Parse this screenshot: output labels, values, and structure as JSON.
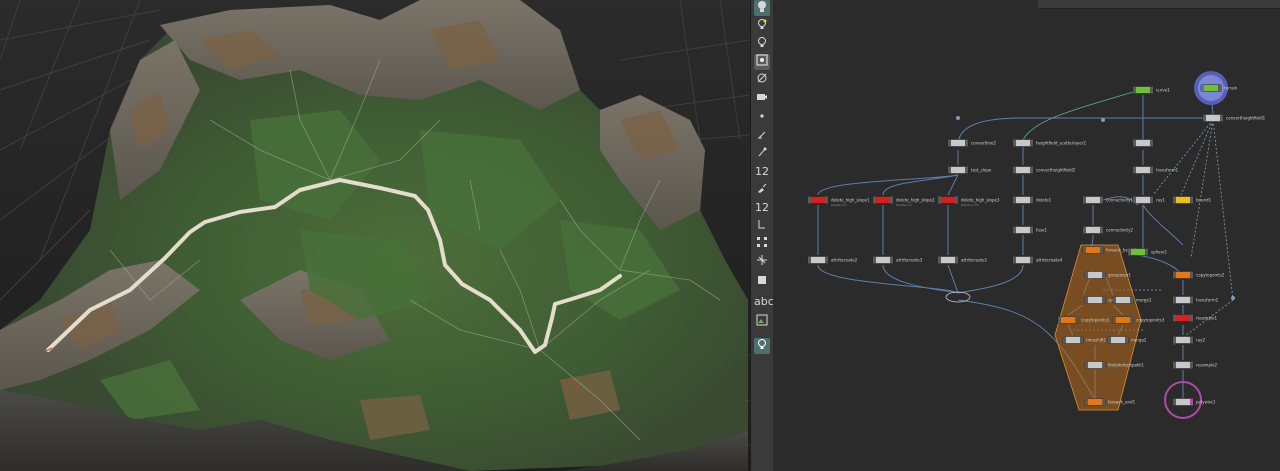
{
  "toolbar": {
    "tools": [
      {
        "icon": "select-icon"
      },
      {
        "icon": "light-bulb-icon"
      },
      {
        "icon": "light-bulb-icon"
      },
      {
        "icon": "display-options-icon"
      },
      {
        "icon": "snapping-icon"
      },
      {
        "icon": "camera-icon"
      },
      {
        "icon": "point-icon"
      },
      {
        "icon": "normals-icon"
      },
      {
        "icon": "pick-icon"
      },
      {
        "icon": "vertex-numbers-icon",
        "label": "12"
      },
      {
        "icon": "paint-icon"
      },
      {
        "icon": "primitive-numbers-icon",
        "label": "12"
      },
      {
        "icon": "wire-icon"
      },
      {
        "icon": "grid-icon"
      },
      {
        "icon": "scale-icon"
      },
      {
        "icon": "visualizer-icon"
      },
      {
        "icon": "text-tool-icon",
        "label": "abc"
      },
      {
        "icon": "image-icon"
      },
      {
        "icon": "light-bulb-icon"
      }
    ]
  },
  "network": {
    "nodes": [
      {
        "name": "curve1",
        "sub": "",
        "color": "#6fbf3a",
        "state": "normal"
      },
      {
        "name": "terrain",
        "sub": "",
        "color": "#6fbf3a",
        "state": "display"
      },
      {
        "name": "convertheightfield1",
        "sub": "",
        "color": "#c8c8c8",
        "state": "normal"
      },
      {
        "name": "convertline2",
        "sub": "",
        "color": "#c8c8c8",
        "state": "normal"
      },
      {
        "name": "heightfield_scatterlayer2",
        "sub": "",
        "color": "#c8c8c8",
        "state": "normal"
      },
      {
        "name": "",
        "sub": "",
        "color": "#c8c8c8",
        "state": "normal"
      },
      {
        "name": "test_slope",
        "sub": "",
        "color": "#c8c8c8",
        "state": "normal"
      },
      {
        "name": "convertheightfield2",
        "sub": "",
        "color": "#c8c8c8",
        "state": "normal"
      },
      {
        "name": "transform1",
        "sub": "",
        "color": "#c8c8c8",
        "state": "normal"
      },
      {
        "name": "delete_high_slope1",
        "sub": "Delete 0.3",
        "color": "#d42020",
        "state": "normal"
      },
      {
        "name": "delete_high_slope2",
        "sub": "Delete 0.3",
        "color": "#d42020",
        "state": "normal"
      },
      {
        "name": "delete_high_slope3",
        "sub": "Delete 0.35",
        "color": "#d42020",
        "state": "normal"
      },
      {
        "name": "delete1",
        "sub": "",
        "color": "#c8c8c8",
        "state": "normal"
      },
      {
        "name": "connectivity1",
        "sub": "",
        "color": "#c8c8c8",
        "state": "normal"
      },
      {
        "name": "ray1",
        "sub": "",
        "color": "#c8c8c8",
        "state": "normal"
      },
      {
        "name": "bound1",
        "sub": "",
        "color": "#e8c020",
        "state": "normal"
      },
      {
        "name": "fuse1",
        "sub": "",
        "color": "#c8c8c8",
        "state": "normal"
      },
      {
        "name": "connectivity2",
        "sub": "",
        "color": "#c8c8c8",
        "state": "normal"
      },
      {
        "name": "attribcreate2",
        "sub": "",
        "color": "#c8c8c8",
        "state": "normal"
      },
      {
        "name": "attribcreate3",
        "sub": "",
        "color": "#c8c8c8",
        "state": "normal"
      },
      {
        "name": "attribcreate1",
        "sub": "",
        "color": "#c8c8c8",
        "state": "normal"
      },
      {
        "name": "attribcreate4",
        "sub": "",
        "color": "#c8c8c8",
        "state": "normal"
      },
      {
        "name": "foreach_begin1",
        "sub": "",
        "color": "#e07818",
        "state": "normal"
      },
      {
        "name": "sphere1",
        "sub": "",
        "color": "#6fbf3a",
        "state": "normal"
      },
      {
        "name": "groupexpr1",
        "sub": "",
        "color": "#c8c8c8",
        "state": "normal"
      },
      {
        "name": "copytopoints2",
        "sub": "",
        "color": "#e07818",
        "state": "normal"
      },
      {
        "name": "split1",
        "sub": "",
        "color": "#c8c8c8",
        "state": "normal"
      },
      {
        "name": "merge1",
        "sub": "",
        "color": "#c8c8c8",
        "state": "normal"
      },
      {
        "name": "transform2",
        "sub": "",
        "color": "#c8c8c8",
        "state": "normal"
      },
      {
        "name": "copytopoints1",
        "sub": "",
        "color": "#e07818",
        "state": "normal"
      },
      {
        "name": "copytopoints3",
        "sub": "",
        "color": "#e07818",
        "state": "normal"
      },
      {
        "name": "resample1",
        "sub": "",
        "color": "#d42020",
        "state": "normal"
      },
      {
        "name": "timeshift1",
        "sub": "",
        "color": "#c8c8c8",
        "state": "normal"
      },
      {
        "name": "merge2",
        "sub": "",
        "color": "#c8c8c8",
        "state": "normal"
      },
      {
        "name": "ray2",
        "sub": "",
        "color": "#c8c8c8",
        "state": "normal"
      },
      {
        "name": "findshortestpath1",
        "sub": "",
        "color": "#c8c8c8",
        "state": "normal"
      },
      {
        "name": "resample2",
        "sub": "",
        "color": "#c8c8c8",
        "state": "normal"
      },
      {
        "name": "foreach_end1",
        "sub": "",
        "color": "#e07818",
        "state": "normal"
      },
      {
        "name": "polywire1",
        "sub": "",
        "color": "#c8c8c8",
        "state": "output"
      }
    ]
  }
}
